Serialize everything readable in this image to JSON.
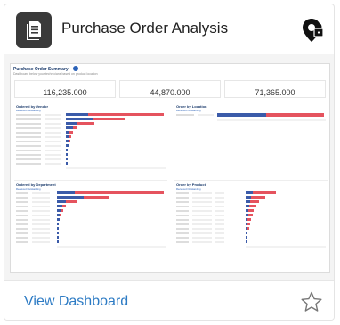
{
  "card": {
    "title": "Purchase Order Analysis",
    "doc_icon": "document-icon",
    "status_icon": "location-lock-icon",
    "view_label": "View Dashboard",
    "favorite_icon": "star-outline-icon"
  },
  "thumbnail": {
    "title": "Purchase Order Summary",
    "subtitle": "Dashboard below your technicians based on product location",
    "kpis": [
      {
        "value": "116,235.000"
      },
      {
        "value": "44,870.000"
      },
      {
        "value": "71,365.000"
      }
    ],
    "panels": [
      {
        "title": "Ordered by Vendor",
        "legend": "Received  Outstanding"
      },
      {
        "title": "Order by Location",
        "legend": "Received  Outstanding"
      },
      {
        "title": "Ordered by Department",
        "legend": "Received  Outstanding"
      },
      {
        "title": "Order by Product",
        "legend": "Received  Outstanding"
      }
    ],
    "colors": {
      "received": "#3b5ba9",
      "outstanding": "#e5535e"
    }
  }
}
